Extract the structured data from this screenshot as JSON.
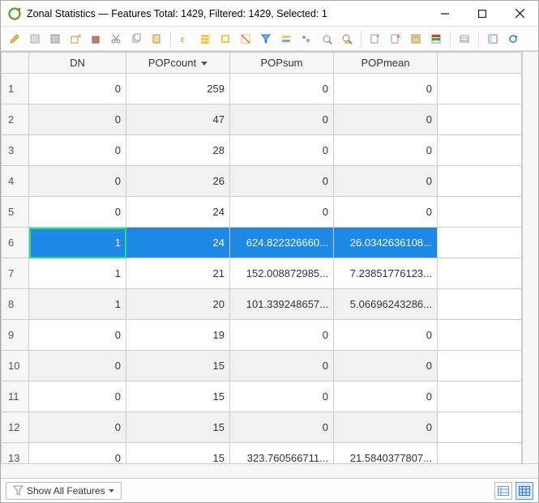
{
  "window": {
    "title": "Zonal Statistics — Features Total: 1429, Filtered: 1429, Selected: 1"
  },
  "columns": {
    "c1": "DN",
    "c2": "POPcount",
    "c3": "POPsum",
    "c4": "POPmean",
    "sorted": "c2",
    "sortDir": "desc"
  },
  "status": {
    "filterLabel": "Show All Features"
  },
  "selectedRow": 6,
  "rows": [
    {
      "n": "1",
      "dn": "0",
      "pc": "259",
      "ps": "0",
      "pm": "0"
    },
    {
      "n": "2",
      "dn": "0",
      "pc": "47",
      "ps": "0",
      "pm": "0"
    },
    {
      "n": "3",
      "dn": "0",
      "pc": "28",
      "ps": "0",
      "pm": "0"
    },
    {
      "n": "4",
      "dn": "0",
      "pc": "26",
      "ps": "0",
      "pm": "0"
    },
    {
      "n": "5",
      "dn": "0",
      "pc": "24",
      "ps": "0",
      "pm": "0"
    },
    {
      "n": "6",
      "dn": "1",
      "pc": "24",
      "ps": "624.822326660...",
      "pm": "26.0342636108..."
    },
    {
      "n": "7",
      "dn": "1",
      "pc": "21",
      "ps": "152.008872985...",
      "pm": "7.23851776123..."
    },
    {
      "n": "8",
      "dn": "1",
      "pc": "20",
      "ps": "101.339248657...",
      "pm": "5.06696243286..."
    },
    {
      "n": "9",
      "dn": "0",
      "pc": "19",
      "ps": "0",
      "pm": "0"
    },
    {
      "n": "10",
      "dn": "0",
      "pc": "15",
      "ps": "0",
      "pm": "0"
    },
    {
      "n": "11",
      "dn": "0",
      "pc": "15",
      "ps": "0",
      "pm": "0"
    },
    {
      "n": "12",
      "dn": "0",
      "pc": "15",
      "ps": "0",
      "pm": "0"
    },
    {
      "n": "13",
      "dn": "0",
      "pc": "15",
      "ps": "323.760566711...",
      "pm": "21.5840377807..."
    }
  ],
  "toolbarIcons": [
    "pencil-icon",
    "edit-multi-icon",
    "save-icon",
    "add-feature-icon",
    "delete-icon",
    "cut-icon",
    "copy-icon",
    "paste-icon",
    "sep",
    "expr-select-icon",
    "select-all-icon",
    "invert-select-icon",
    "deselect-icon",
    "filter-icon",
    "select-equal-icon",
    "move-top-icon",
    "pan-to-icon",
    "zoom-to-icon",
    "sep",
    "new-field-icon",
    "delete-field-icon",
    "field-calc-icon",
    "conditional-format-icon",
    "sep",
    "actions-icon",
    "sep",
    "dock-icon",
    "reload-icon"
  ]
}
